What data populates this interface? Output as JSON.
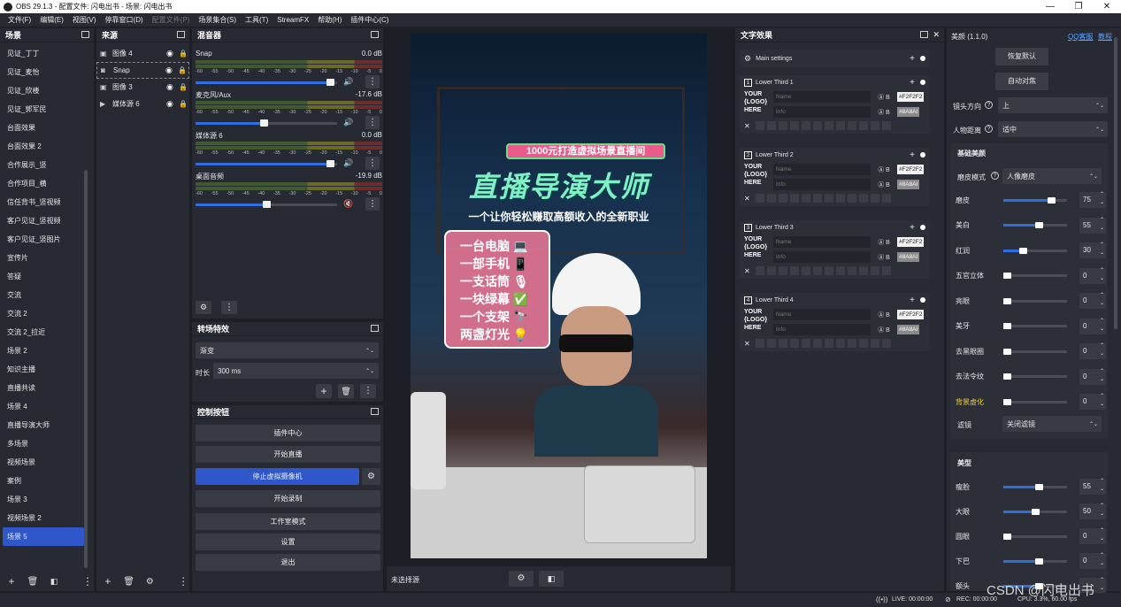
{
  "window": {
    "title": "OBS 29.1.3 - 配置文件: 闪电出书 - 场景: 闪电出书"
  },
  "menu": [
    "文件(F)",
    "编辑(E)",
    "视图(V)",
    "停靠窗口(D)",
    "配置文件(P)",
    "场景集合(S)",
    "工具(T)",
    "StreamFX",
    "帮助(H)",
    "插件中心(C)"
  ],
  "scenes": {
    "title": "场景",
    "items": [
      "见证_丁丁",
      "见证_麦怡",
      "见证_欣楼",
      "见证_郭军民",
      "台面效果",
      "台面效果 2",
      "合作展示_竖",
      "合作项目_横",
      "信任背书_竖视频",
      "客户见证_竖视频",
      "客户见证_竖图片",
      "宣传片",
      "答疑",
      "交流",
      "交流 2",
      "交流 2_拉近",
      "场景 2",
      "知识主播",
      "直播共读",
      "场景 4",
      "直播导演大师",
      "多场景",
      "视频场景",
      "案例",
      "场景 3",
      "视频场景 2",
      "场景 5"
    ],
    "selected": "场景 5"
  },
  "sources": {
    "title": "来源",
    "items": [
      {
        "name": "图像 4",
        "icon": "image-icon"
      },
      {
        "name": "Snap",
        "icon": "camera-icon"
      },
      {
        "name": "图像 3",
        "icon": "image-icon"
      },
      {
        "name": "媒体源 6",
        "icon": "play-icon"
      }
    ]
  },
  "mixer": {
    "title": "混音器",
    "ticks": [
      "-60",
      "-55",
      "-50",
      "-45",
      "-40",
      "-35",
      "-30",
      "-25",
      "-20",
      "-15",
      "-10",
      "-5",
      "0"
    ],
    "channels": [
      {
        "name": "Snap",
        "db": "0.0 dB",
        "level": 0.95,
        "muted": false
      },
      {
        "name": "麦克风/Aux",
        "db": "-17.6 dB",
        "level": 0.48,
        "muted": false
      },
      {
        "name": "媒体源 6",
        "db": "0.0 dB",
        "level": 0.95,
        "muted": false
      },
      {
        "name": "桌面音频",
        "db": "-19.9 dB",
        "level": 0.5,
        "muted": true
      }
    ]
  },
  "transitions": {
    "title": "转场特效",
    "type": "渐变",
    "duration_label": "时长",
    "duration": "300 ms"
  },
  "controls": {
    "title": "控制按钮",
    "buttons": [
      "插件中心",
      "开始直播",
      "停止虚拟摄像机",
      "开始录制",
      "工作室模式",
      "设置",
      "退出"
    ],
    "active": "停止虚拟摄像机"
  },
  "preview": {
    "no_source": "未选择源"
  },
  "canvas": {
    "banner": "1000元打造虚拟场景直播间",
    "title": "直播导演大师",
    "subtitle": "一个让你轻松赚取高额收入的全新职业",
    "list": [
      "一台电脑 💻",
      "一部手机 📱",
      "一支话筒 🎙",
      "一块绿幕 ✅",
      "一个支架 🔭",
      "两盏灯光 💡"
    ]
  },
  "text_effects": {
    "title": "文字效果",
    "main": "Main settings",
    "items": [
      {
        "num": "1",
        "name": "Lower Third 1"
      },
      {
        "num": "2",
        "name": "Lower Third 2"
      },
      {
        "num": "3",
        "name": "Lower Third 3"
      },
      {
        "num": "4",
        "name": "Lower Third 4"
      }
    ],
    "name_ph": "Name",
    "info_ph": "Info",
    "color1": "#F2F2F2",
    "color2": "#8A8AI",
    "logo_lines": [
      "YOUR",
      "{LOGO}",
      "HERE"
    ]
  },
  "beauty": {
    "title": "美颜 (1.1.0)",
    "qq_link": "QQ客服",
    "tutorial_link": "教程",
    "reset_btn": "恢复默认",
    "auto_btn": "自动对焦",
    "camera_dir_label": "镜头方向",
    "camera_dir": "上",
    "distance_label": "人物距离",
    "distance": "适中",
    "basic_title": "基础美颜",
    "skin_mode_label": "磨皮模式",
    "skin_mode": "人像磨皮",
    "sliders": [
      {
        "label": "磨皮",
        "value": "75",
        "frac": 0.75
      },
      {
        "label": "美白",
        "value": "55",
        "frac": 0.55
      },
      {
        "label": "红润",
        "value": "30",
        "frac": 0.3
      },
      {
        "label": "五官立体",
        "value": "0",
        "frac": 0
      },
      {
        "label": "亮眼",
        "value": "0",
        "frac": 0
      },
      {
        "label": "美牙",
        "value": "0",
        "frac": 0
      },
      {
        "label": "去黑眼圈",
        "value": "0",
        "frac": 0
      },
      {
        "label": "去法令纹",
        "value": "0",
        "frac": 0
      },
      {
        "label": "背景虚化",
        "value": "0",
        "frac": 0
      }
    ],
    "filter_label": "滤镜",
    "filter": "关闭滤镜",
    "shape_title": "美型",
    "shape_sliders": [
      {
        "label": "瘦脸",
        "value": "55",
        "frac": 0.55
      },
      {
        "label": "大眼",
        "value": "50",
        "frac": 0.5
      },
      {
        "label": "圆眼",
        "value": "0",
        "frac": 0
      },
      {
        "label": "下巴",
        "value": "0",
        "frac": 0.55
      },
      {
        "label": "额头",
        "value": "",
        "frac": 0.55
      }
    ]
  },
  "status": {
    "live": "LIVE: 00:00:00",
    "rec": "REC: 00:00:00",
    "cpu": "CPU: 3.3%, 60.00 fps"
  },
  "watermark": "CSDN @闪电出书"
}
